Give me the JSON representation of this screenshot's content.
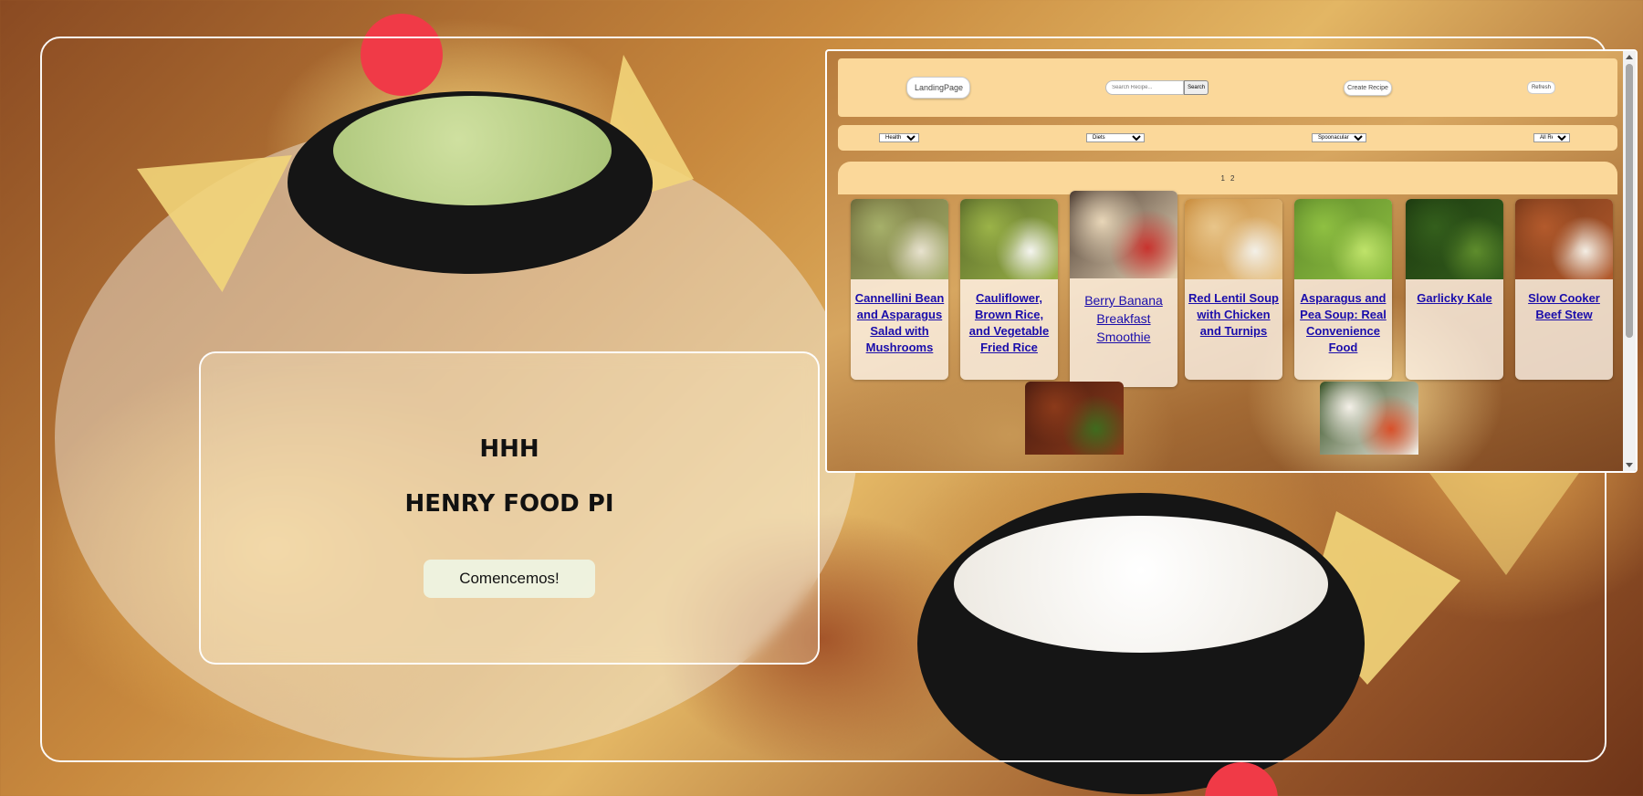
{
  "landing": {
    "title": "HHH",
    "subtitle": "HENRY FOOD PI",
    "start_button": "Comencemos!"
  },
  "app": {
    "navbar": {
      "landing_button": "LandingPage",
      "search_placeholder": "Search Recipe...",
      "search_button": "Search",
      "create_button": "Create Recipe",
      "refresh_button": "Refresh"
    },
    "filters": {
      "health_score": "Health Score",
      "diets": "Diets",
      "spoonacular_score": "Spoonacular Score",
      "all_recipes": "All Recipes"
    },
    "pagination": {
      "pages": [
        "1",
        "2"
      ]
    },
    "recipes": [
      {
        "title": "Cannellini Bean and Asparagus Salad with Mushrooms",
        "image": "salad-image",
        "colors": [
          "#6d6a3a",
          "#a6b06a",
          "#e8e2cf"
        ]
      },
      {
        "title": "Cauliflower, Brown Rice, and Vegetable Fried Rice",
        "image": "fried-rice-image",
        "colors": [
          "#5a6b2a",
          "#9bb348",
          "#f5f5f0"
        ]
      },
      {
        "title": "Berry Banana Breakfast Smoothie",
        "image": "smoothie-image",
        "colors": [
          "#4a3a30",
          "#e8d6b8",
          "#c8332e"
        ]
      },
      {
        "title": "Red Lentil Soup with Chicken and Turnips",
        "image": "soup-image",
        "colors": [
          "#c98c3c",
          "#e8c58a",
          "#f3f0e8"
        ]
      },
      {
        "title": "Asparagus and Pea Soup: Real Convenience Food",
        "image": "pea-soup-image",
        "colors": [
          "#5f8a2a",
          "#8fc042",
          "#bfe36a"
        ]
      },
      {
        "title": "Garlicky Kale",
        "image": "kale-image",
        "colors": [
          "#1d3a10",
          "#345f1c",
          "#5e8c2c"
        ]
      },
      {
        "title": "Slow Cooker Beef Stew",
        "image": "beef-stew-image",
        "colors": [
          "#7a3a1a",
          "#b35a2c",
          "#f4eee4"
        ]
      }
    ],
    "second_row_images": [
      {
        "image": "stir-fry-image",
        "colors": [
          "#4a1c10",
          "#8b3a1a",
          "#3f6b1e"
        ]
      },
      {
        "image": "stuffed-peppers-image",
        "colors": [
          "#2e4a1c",
          "#f4f0e8",
          "#d8502a"
        ]
      }
    ]
  }
}
